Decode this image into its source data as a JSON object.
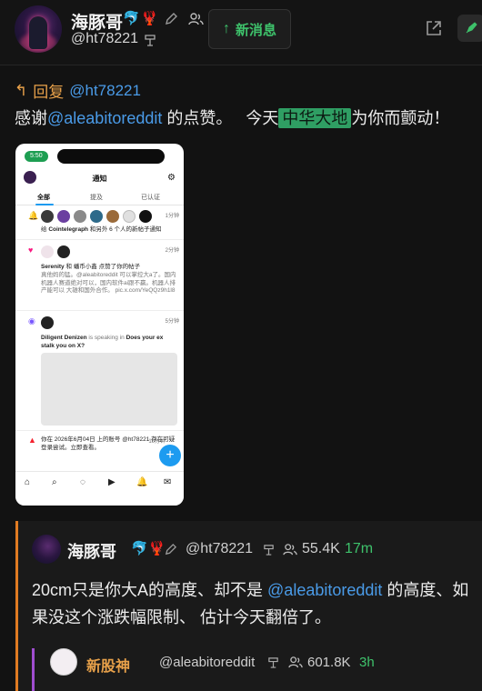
{
  "header": {
    "name": "海豚哥",
    "handle": "@ht78221",
    "new_messages_label": "新消息",
    "new_messages_arrow": "↑",
    "badges": [
      "🐬",
      "🦞"
    ]
  },
  "post": {
    "reply_prefix": "回复",
    "reply_handle": "@ht78221",
    "text_before": "感谢",
    "mention": "@aleabitoreddit",
    "text_middle": " 的点赞。   今天",
    "highlight": "中华大地",
    "text_after": "为你而颤动！"
  },
  "embedded_screenshot": {
    "status_time": "5:50",
    "title": "通知",
    "tabs": [
      "全部",
      "提及",
      "已认证"
    ],
    "notifications": [
      {
        "time": "1分钟",
        "text_bold": "Cointelegraph",
        "text": "和另外 6 个人的新帖子通知",
        "prefix": "给"
      },
      {
        "time": "2分钟",
        "text_bold": "Serenity",
        "text": "和 蟠币小鑫 点赞了你的帖子",
        "body": "真他妈的猛。@aleabitoreddit 可以掌控大a了。国内机器人赛道绝对可以，国内软件ai跟不赢。机器人排产能可以 大雄和国外合作。 pic.x.com/YeQQz9h1l8"
      },
      {
        "time": "5分钟",
        "text_bold": "Diligent Denizen",
        "text": "is speaking in",
        "text_bold2": "Does your ex stalk you on X?"
      },
      {
        "time": "16分钟",
        "text": "你在 2026年6月04日 上的账号 @ht78221 存在可疑登录尝试。立即查看。"
      }
    ]
  },
  "quote": {
    "name": "海豚哥",
    "handle": "@ht78221",
    "followers": "55.4K",
    "time": "17m",
    "text_before": "20cm只是你大A的高度、却不是 ",
    "mention": "@aleabitoreddit",
    "text_after": " 的高度、如果没这个涨跌幅限制、 估计今天翻倍了。",
    "badges": [
      "🐬",
      "🦞"
    ]
  },
  "inner_quote": {
    "name": "新股神",
    "handle": "@aleabitoreddit",
    "followers": "601.8K",
    "time": "3h"
  },
  "colors": {
    "accent_green": "#3ec26b",
    "mention_blue": "#4a9be8",
    "reply_orange": "#e8a14a",
    "quote_border": "#e07b22",
    "inner_border": "#a04dd0"
  }
}
